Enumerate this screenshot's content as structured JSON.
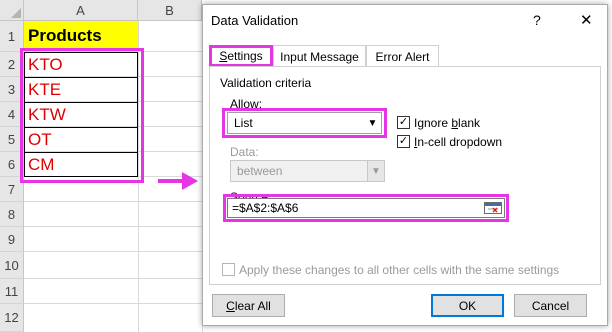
{
  "sheet": {
    "columns": [
      "A",
      "B"
    ],
    "rows": [
      "1",
      "2",
      "3",
      "4",
      "5",
      "6",
      "7",
      "8",
      "9",
      "10",
      "11",
      "12"
    ],
    "header_cell": "Products",
    "values": [
      "KTO",
      "KTE",
      "KTW",
      "OT",
      "CM"
    ],
    "colors": {
      "header_fill": "#ffff00",
      "value_text": "#e00000",
      "highlight": "#e535e5"
    }
  },
  "dialog": {
    "title": "Data Validation",
    "help_icon": "?",
    "close_icon": "✕",
    "tabs": [
      "Settings",
      "Input Message",
      "Error Alert"
    ],
    "active_tab": "Settings",
    "group_label": "Validation criteria",
    "allow": {
      "label": "Allow:",
      "value": "List"
    },
    "ignore_blank": {
      "label": "Ignore blank",
      "checked": true
    },
    "incell_dropdown": {
      "label": "In-cell dropdown",
      "checked": true
    },
    "data": {
      "label": "Data:",
      "value": "between",
      "enabled": false
    },
    "source": {
      "label": "Source:",
      "value": "=$A$2:$A$6"
    },
    "apply_all": {
      "label": "Apply these changes to all other cells with the same settings",
      "checked": false,
      "enabled": false
    },
    "buttons": {
      "clear_all": "Clear All",
      "ok": "OK",
      "cancel": "Cancel"
    }
  }
}
